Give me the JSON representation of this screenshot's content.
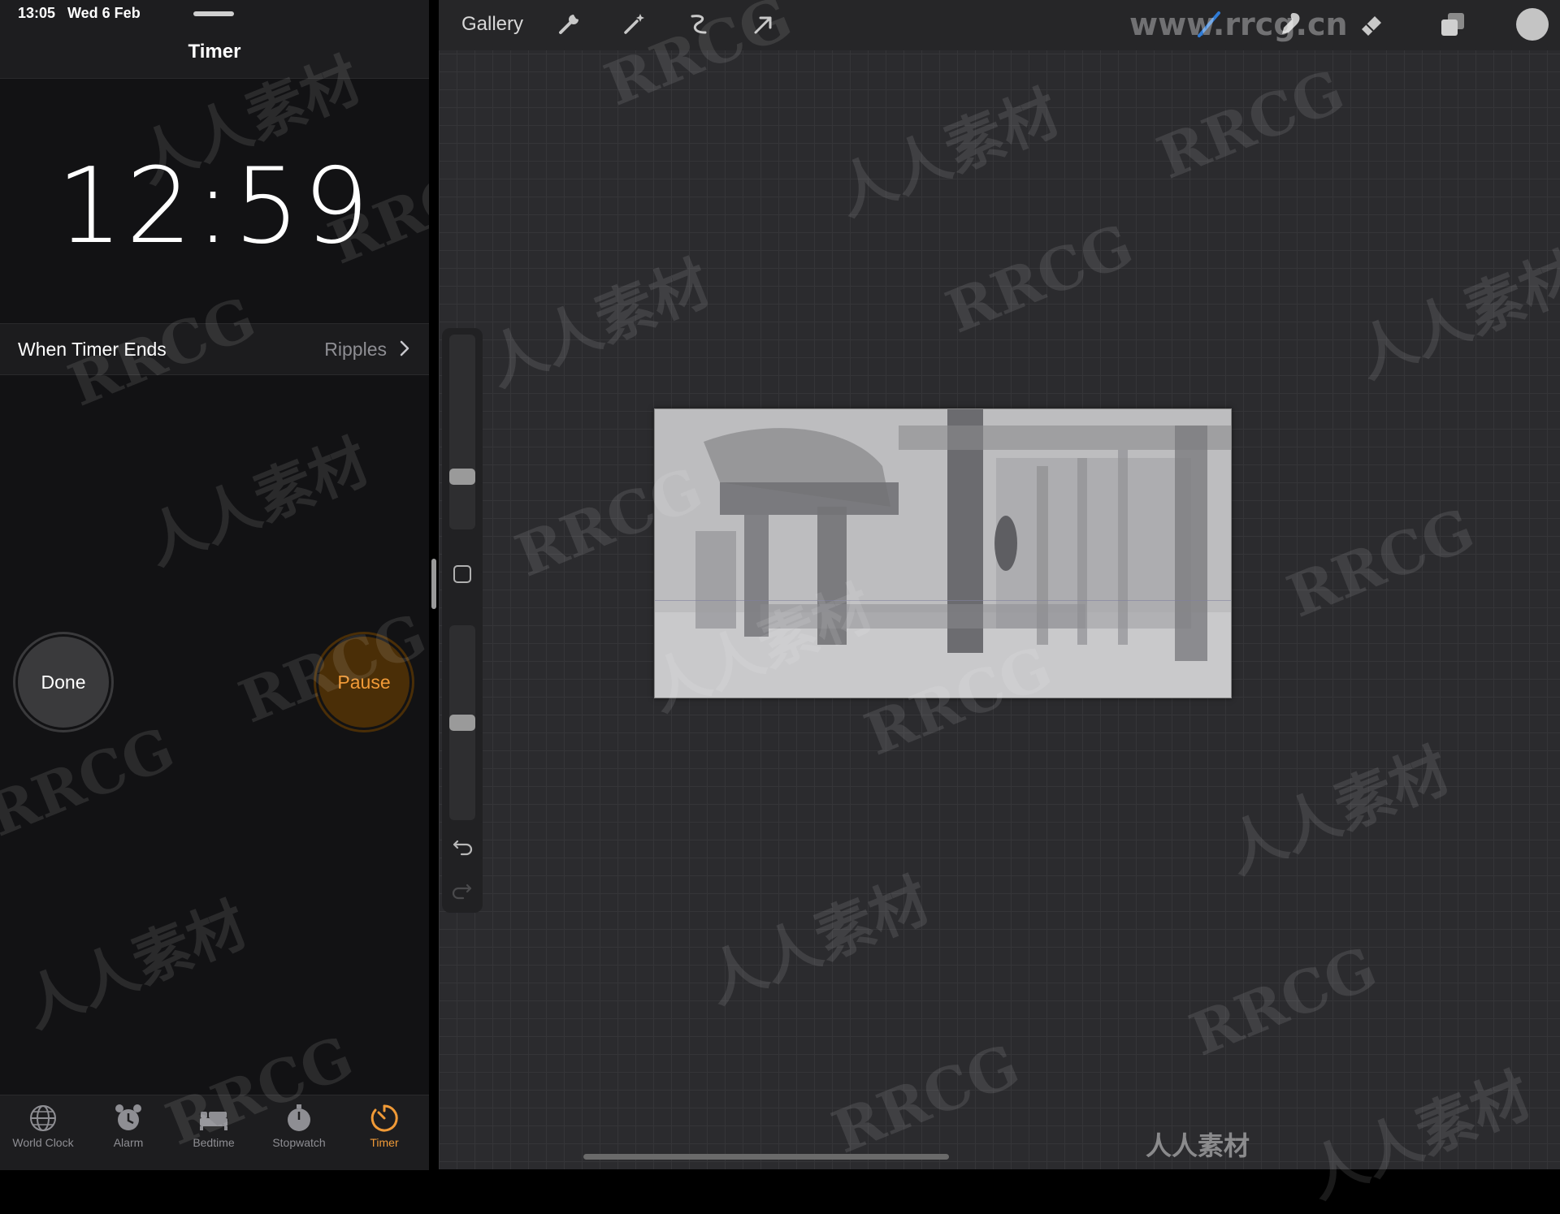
{
  "status_bar": {
    "time": "13:05",
    "date": "Wed 6 Feb"
  },
  "clock_app": {
    "title": "Timer",
    "countdown": "12:59",
    "when_timer_ends": {
      "label": "When Timer Ends",
      "value": "Ripples"
    },
    "done_label": "Done",
    "pause_label": "Pause",
    "tabs": [
      {
        "label": "World Clock",
        "icon": "globe-icon",
        "active": false
      },
      {
        "label": "Alarm",
        "icon": "alarm-clock-icon",
        "active": false
      },
      {
        "label": "Bedtime",
        "icon": "bed-icon",
        "active": false
      },
      {
        "label": "Stopwatch",
        "icon": "stopwatch-icon",
        "active": false
      },
      {
        "label": "Timer",
        "icon": "timer-icon",
        "active": true
      }
    ],
    "accent_color": "#f09a37"
  },
  "procreate": {
    "gallery_label": "Gallery",
    "toolbar_icons": [
      "wrench-icon",
      "magic-wand-icon",
      "selection-icon",
      "transform-arrow-icon",
      "brush-icon",
      "smudge-icon",
      "eraser-icon",
      "layers-icon",
      "color-swatch-icon"
    ],
    "brush_size_level": 0.25,
    "opacity_level": 0.5,
    "brush_color": "#2f7bd6"
  },
  "watermarks": {
    "url": "www.rrcg.cn",
    "latin": "RRCG",
    "chinese": "人人素材"
  }
}
